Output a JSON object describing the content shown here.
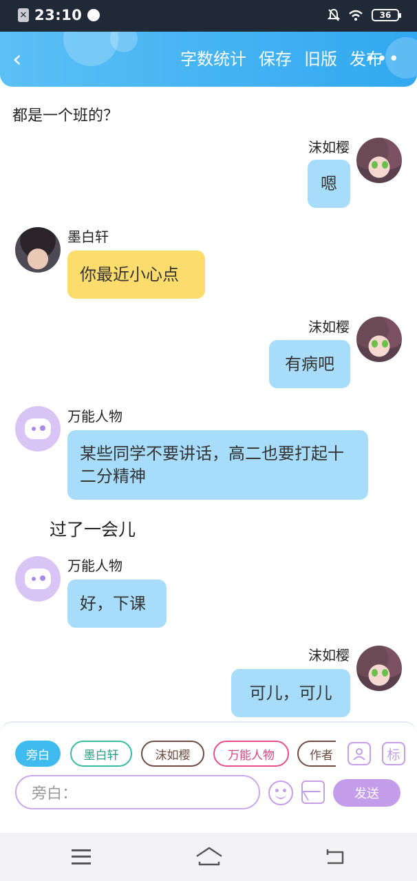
{
  "status_bar": {
    "time": "23:10",
    "battery": "36"
  },
  "header": {
    "back_label": "‹",
    "actions": [
      "字数统计",
      "保存",
      "旧版",
      "发布"
    ],
    "more_label": "•••"
  },
  "chat": {
    "intro_narration": "都是一个班的？",
    "messages": [
      {
        "name": "沫如樱",
        "text": "嗯",
        "side": "right",
        "color": "blue"
      },
      {
        "name": "墨白轩",
        "text": "你最近小心点",
        "side": "left",
        "color": "yellow"
      },
      {
        "name": "沫如樱",
        "text": "有病吧",
        "side": "right",
        "color": "blue"
      },
      {
        "name": "万能人物",
        "text": "某些同学不要讲话，高二也要打起十二分精神",
        "side": "left",
        "color": "blue"
      },
      {
        "name": "万能人物",
        "text": "好，下课",
        "side": "left",
        "color": "blue"
      },
      {
        "name": "沫如樱",
        "text": "可儿，可儿",
        "side": "right",
        "color": "blue"
      }
    ],
    "narration_2": "过了一会儿"
  },
  "composer": {
    "roles": [
      "旁白",
      "墨白轩",
      "沫如樱",
      "万能人物",
      "作者"
    ],
    "role_tool_icon": "person-icon",
    "tag_button": "标",
    "input_placeholder": "旁白：",
    "send_label": "发送"
  }
}
